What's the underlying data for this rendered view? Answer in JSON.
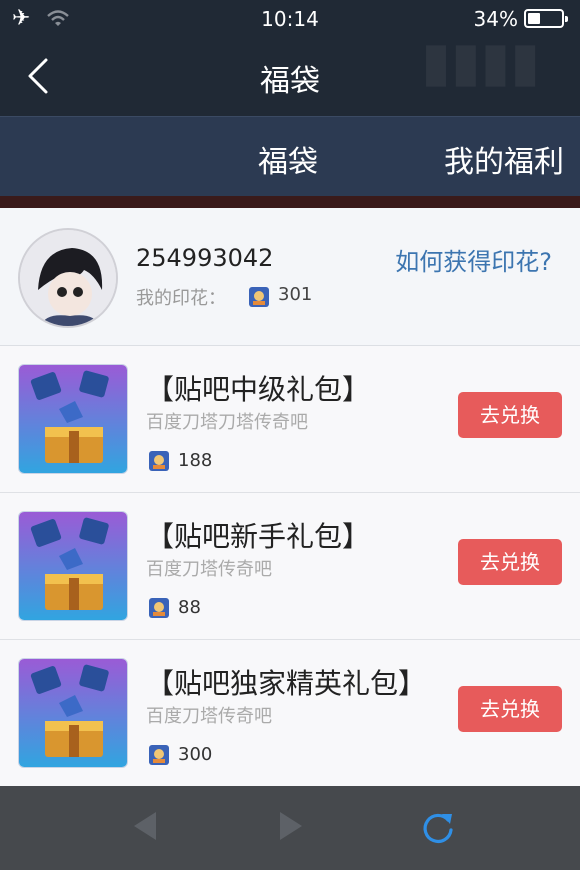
{
  "status_bar": {
    "time": "10:14",
    "battery_pct": "34%",
    "battery_level": 0.34
  },
  "nav": {
    "title": "福袋"
  },
  "tabs": [
    {
      "label": "福袋"
    },
    {
      "label": "我的福利"
    }
  ],
  "profile": {
    "user_id": "254993042",
    "stamp_label": "我的印花：",
    "stamp_count": "301",
    "how_to_link": "如何获得印花?"
  },
  "gifts": [
    {
      "name": "【贴吧中级礼包】",
      "source": "百度刀塔刀塔传奇吧",
      "cost": "188",
      "button": "去兑换"
    },
    {
      "name": "【贴吧新手礼包】",
      "source": "百度刀塔传奇吧",
      "cost": "88",
      "button": "去兑换"
    },
    {
      "name": "【贴吧独家精英礼包】",
      "source": "百度刀塔传奇吧",
      "cost": "300",
      "button": "去兑换"
    }
  ],
  "colors": {
    "topbar": "#202935",
    "tabbar": "#2c3a52",
    "accent_link": "#3c75b0",
    "exchange_button": "#e75b5b",
    "refresh_icon": "#2f8fe6"
  },
  "icons": {
    "back": "chevron-left-icon",
    "stamp": "stamp-icon",
    "nav_back": "triangle-left-icon",
    "nav_forward": "triangle-right-icon",
    "refresh": "refresh-icon"
  }
}
